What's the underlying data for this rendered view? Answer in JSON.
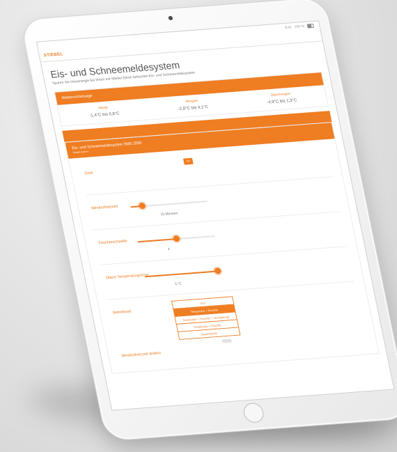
{
  "app": {
    "logo_text": "STIEBEL",
    "status_time": "9:41",
    "status_battery": "100 %"
  },
  "page": {
    "title": "Eis- und Schneemeldesystem",
    "intro": "Sparen Sie Heizenergie bei Ihrem mit Stiebel Eltron beheizten Eis- und Schneemeldesystem"
  },
  "weather": {
    "header": "Wettervorhersage",
    "days": [
      {
        "label": "Heute",
        "temp": "-1,4°C bis 6,8°C"
      },
      {
        "label": "Morgen",
        "temp": "-2,8°C bis 4,1°C"
      },
      {
        "label": "Übermorgen",
        "temp": "-4,9°C bis 1,3°C"
      }
    ]
  },
  "system": {
    "header": "Eis- und Schneemeldesystem SMS 2000",
    "subheader": "Details ändern",
    "zone": {
      "label": "Zone",
      "toggle_label": "Ein"
    },
    "sliders": [
      {
        "label": "Mindestheizzeit",
        "value": "15 Minuten",
        "level": 0.15
      },
      {
        "label": "Feuchteschwelle",
        "value": "4",
        "level": 0.5
      },
      {
        "label": "Obere Temperaturgrenze",
        "value": "3 °C",
        "level": 0.95
      }
    ],
    "mode": {
      "label": "Betriebsart",
      "options": [
        {
          "label": "Aus",
          "selected": false
        },
        {
          "label": "Temperatur + Feuchte",
          "selected": true
        },
        {
          "label": "Temperatur + Feuchte + Verzögerung",
          "selected": false
        },
        {
          "label": "Temperatur + Feuchte",
          "selected": false
        },
        {
          "label": "Dauerbetrieb",
          "selected": false
        }
      ]
    },
    "footer_label": "Mindestheizzeit ändern"
  },
  "colors": {
    "accent": "#ef7d22",
    "text": "#555555"
  }
}
